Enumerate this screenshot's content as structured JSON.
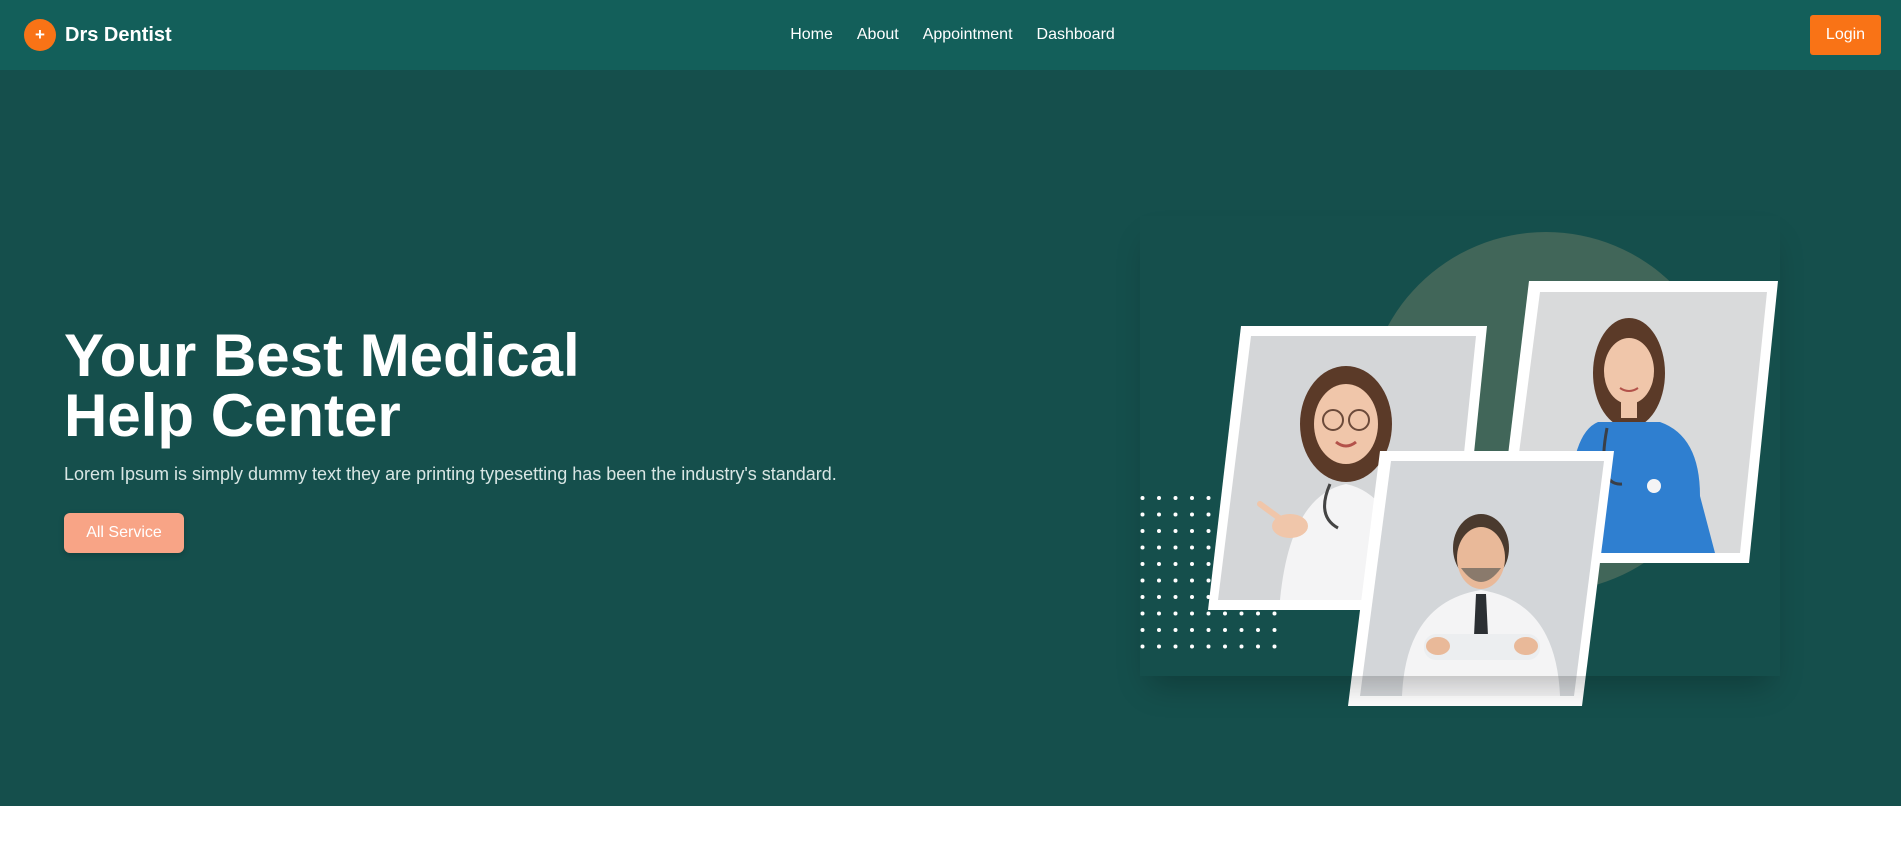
{
  "brand": {
    "logo_glyph": "+",
    "name": "Drs Dentist"
  },
  "nav": {
    "items": [
      "Home",
      "About",
      "Appointment",
      "Dashboard"
    ]
  },
  "header": {
    "login_label": "Login"
  },
  "hero": {
    "title_line1": "Your Best Medical",
    "title_line2": "Help Center",
    "subtitle": "Lorem Ipsum is simply dummy text they are printing typesetting has been the industry's standard.",
    "button_label": "All Service"
  },
  "colors": {
    "nav_bg": "#135f5a",
    "hero_bg": "#154f4c",
    "accent": "#f97316",
    "button_soft": "#f8a486",
    "circle": "#416659"
  }
}
